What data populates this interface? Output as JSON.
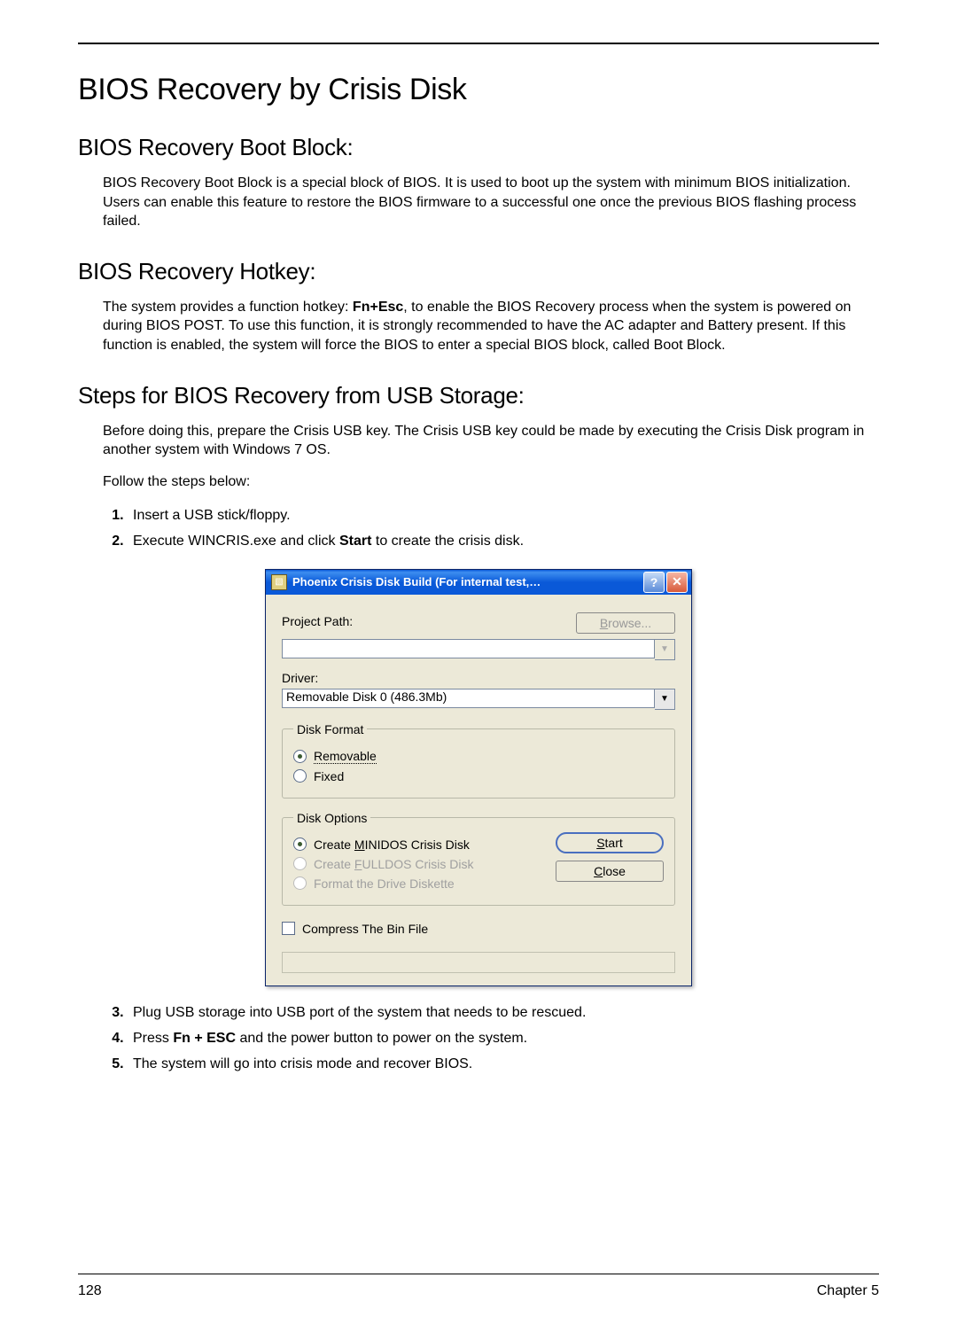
{
  "heading": "BIOS Recovery by Crisis Disk",
  "section1": {
    "title": "BIOS Recovery Boot Block:",
    "para": "BIOS Recovery Boot Block is a special block of BIOS. It is used to boot up the system with minimum BIOS initialization. Users can enable this feature to restore the BIOS firmware to a successful one once the previous BIOS flashing process failed."
  },
  "section2": {
    "title": "BIOS Recovery Hotkey:",
    "para_pre": "The system provides a function hotkey: ",
    "hotkey": "Fn+Esc",
    "para_post": ", to enable the BIOS Recovery process when the system is powered on during BIOS POST. To use this function, it is strongly recommended to have the AC adapter and Battery present. If this function is enabled, the system will force the BIOS to enter a special BIOS block, called Boot Block."
  },
  "section3": {
    "title": "Steps for BIOS Recovery from USB Storage:",
    "intro": "Before doing this, prepare the Crisis USB key. The Crisis USB key could be made by executing the Crisis Disk program in another system with Windows 7 OS.",
    "follow": "Follow the steps below:",
    "steps12": {
      "s1": "Insert a USB stick/floppy.",
      "s2_pre": "Execute WINCRIS.exe and click ",
      "s2_bold": "Start",
      "s2_post": " to create the crisis disk."
    },
    "steps345": {
      "s3": "Plug USB storage into USB port of the system that needs to be rescued.",
      "s4_pre": "Press ",
      "s4_bold": "Fn + ESC",
      "s4_post": " and the power button to power on the system.",
      "s5": "The system will go into crisis mode and recover BIOS."
    }
  },
  "dialog": {
    "title": "Phoenix Crisis Disk Build (For  internal test,…",
    "project_path_label": "Project Path:",
    "browse": "Browse...",
    "driver_label": "Driver:",
    "driver_value": "Removable Disk 0 (486.3Mb)",
    "disk_format": {
      "legend": "Disk Format",
      "removable": "Removable",
      "fixed": "Fixed"
    },
    "disk_options": {
      "legend": "Disk Options",
      "opt1_pre": "Create ",
      "opt1_u": "M",
      "opt1_post": "INIDOS Crisis Disk",
      "opt2_pre": "Create ",
      "opt2_u": "F",
      "opt2_post": "ULLDOS Crisis Disk",
      "opt3": "Format the Drive Diskette",
      "start_u": "S",
      "start_post": "tart",
      "close_u": "C",
      "close_post": "lose"
    },
    "compress": "Compress The Bin File"
  },
  "footer": {
    "page": "128",
    "chapter": "Chapter 5"
  }
}
